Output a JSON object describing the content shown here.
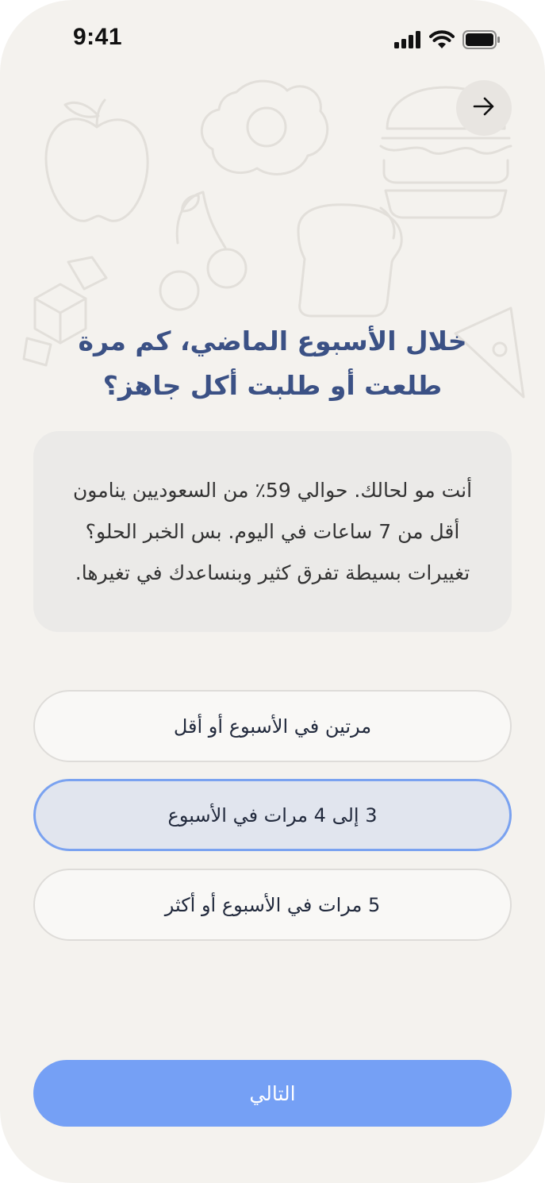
{
  "status_bar": {
    "time": "9:41",
    "icons": [
      "cellular-signal-icon",
      "wifi-icon",
      "battery-icon"
    ]
  },
  "nav": {
    "back_icon": "arrow-right-icon"
  },
  "illustrations": [
    "apple-icon",
    "fried-egg-icon",
    "burger-icon",
    "cherries-icon",
    "bread-icon",
    "sugar-cubes-icon",
    "pizza-slice-icon"
  ],
  "question": {
    "title": "خلال الأسبوع الماضي، كم مرة طلعت أو طلبت أكل جاهز؟"
  },
  "info_card": {
    "text": "أنت مو لحالك. حوالي 59٪ من السعوديين ينامون أقل من 7 ساعات في اليوم. بس الخبر الحلو؟ تغييرات بسيطة تفرق كثير وبنساعدك في تغيرها."
  },
  "options": [
    {
      "label": "مرتين في الأسبوع أو أقل",
      "selected": false
    },
    {
      "label": "3 إلى 4 مرات في الأسبوع",
      "selected": true
    },
    {
      "label": "5 مرات في الأسبوع أو أكثر",
      "selected": false
    }
  ],
  "next_button": {
    "label": "التالي"
  },
  "colors": {
    "background": "#f4f2ee",
    "title": "#3b5185",
    "card": "#ebeae8",
    "selected_border": "#7aa2f0",
    "selected_fill": "#e1e5ee",
    "primary_button": "#75a0f5"
  }
}
